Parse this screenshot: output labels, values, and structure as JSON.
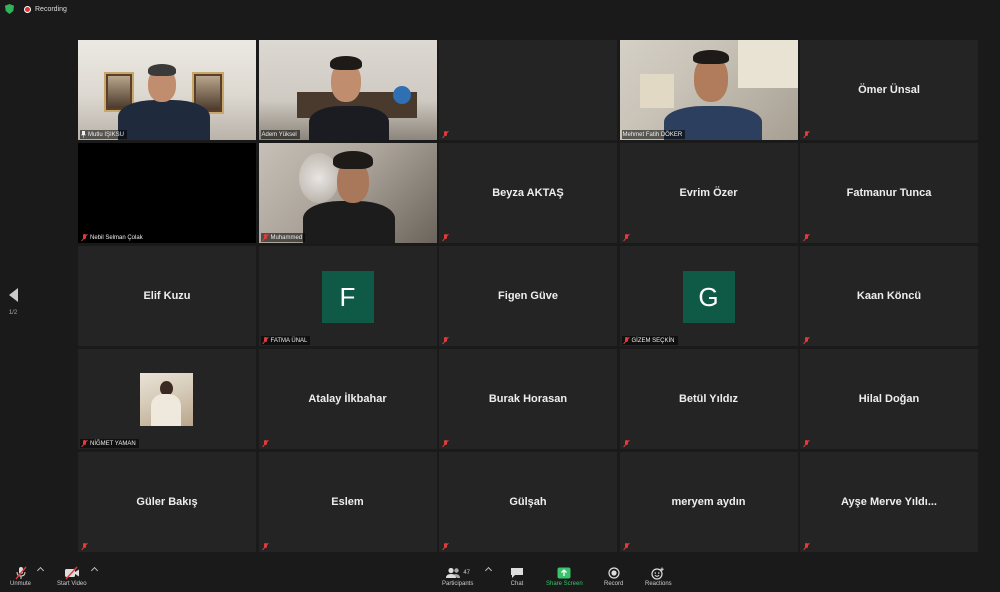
{
  "topbar": {
    "recording_label": "Recording"
  },
  "pagination": {
    "page_indicator": "1/2"
  },
  "tiles": [
    {
      "label": "Mutlu IŞIKSU"
    },
    {
      "label": "Adem Yüksel"
    },
    {
      "label": ""
    },
    {
      "label": "Mehmet Fatih DÖKER"
    },
    {
      "name": "Ömer Ünsal"
    },
    {
      "label": "Nebil Selman Çolak"
    },
    {
      "label": "Muhammed"
    },
    {
      "name": "Beyza AKTAŞ"
    },
    {
      "name": "Evrim Özer"
    },
    {
      "name": "Fatmanur Tunca"
    },
    {
      "name": "Elif Kuzu"
    },
    {
      "letter": "F",
      "label": "FATMA ÜNAL"
    },
    {
      "name": "Figen Güve"
    },
    {
      "letter": "G",
      "label": "GİZEM SEÇKİN"
    },
    {
      "name": "Kaan Köncü"
    },
    {
      "label": "NİĞMET YAMAN"
    },
    {
      "name": "Atalay İlkbahar"
    },
    {
      "name": "Burak Horasan"
    },
    {
      "name": "Betül Yıldız"
    },
    {
      "name": "Hilal Doğan"
    },
    {
      "name": "Güler Bakış"
    },
    {
      "name": "Eslem"
    },
    {
      "name": "Gülşah"
    },
    {
      "name": "meryem aydın"
    },
    {
      "name": "Ayşe Merve Yıldı..."
    }
  ],
  "toolbar": {
    "unmute_label": "Unmute",
    "start_video_label": "Start Video",
    "participants_label": "Participants",
    "participants_count": "47",
    "chat_label": "Chat",
    "share_screen_label": "Share Screen",
    "record_label": "Record",
    "reactions_label": "Reactions"
  },
  "colors": {
    "active_speaker_border": "#c6e23d",
    "share_screen": "#3ac36c",
    "avatar_bg": "#0e5a47",
    "muted": "#e23b3b"
  },
  "icons": [
    "shield-icon",
    "recording-icon",
    "chevron-left-icon",
    "mic-muted-icon",
    "pin-icon",
    "microphone-off-icon",
    "video-off-icon",
    "participants-icon",
    "chat-icon",
    "share-screen-icon",
    "record-icon",
    "reactions-icon"
  ]
}
